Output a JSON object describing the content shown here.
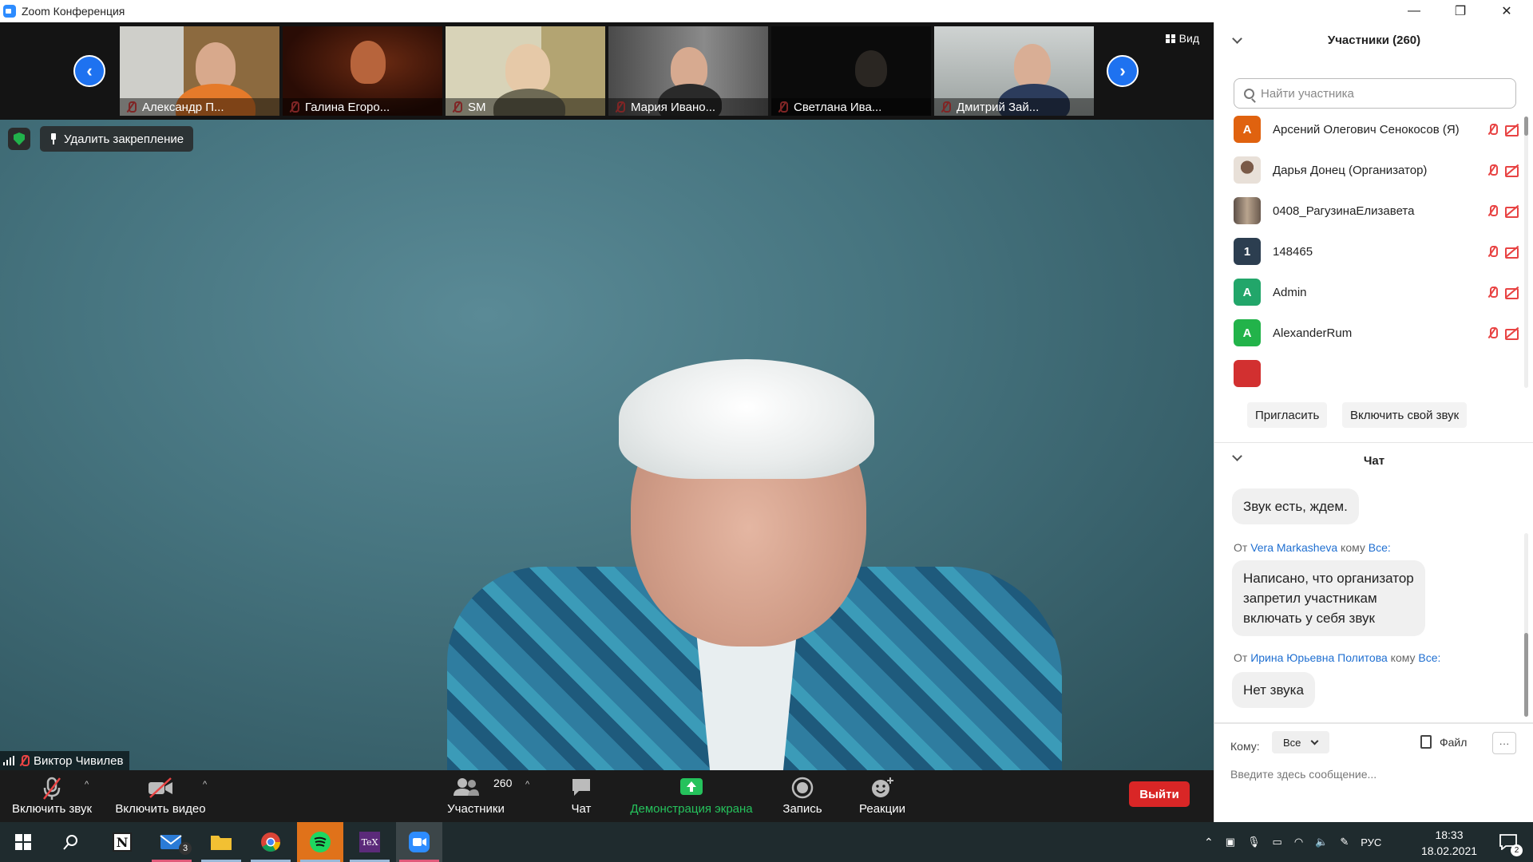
{
  "window": {
    "title": "Zoom Конференция",
    "controls": {
      "minimize": "—",
      "restore": "❐",
      "close": "✕"
    }
  },
  "thumbnails": {
    "view_label": "Вид",
    "items": [
      {
        "name": "Александр П...",
        "mic_muted": true
      },
      {
        "name": "Галина Егоро...",
        "mic_muted": true
      },
      {
        "name": "SM",
        "mic_muted": true
      },
      {
        "name": "Мария Ивано...",
        "mic_muted": true
      },
      {
        "name": "Светлана Ива...",
        "mic_muted": true
      },
      {
        "name": "Дмитрий Зай...",
        "mic_muted": true
      }
    ]
  },
  "main_video": {
    "unpin_label": "Удалить закрепление",
    "speaker_name": "Виктор Чивилев"
  },
  "toolbar": {
    "unmute_label": "Включить звук",
    "video_label": "Включить видео",
    "participants_label": "Участники",
    "participants_count": "260",
    "chat_label": "Чат",
    "share_label": "Демонстрация экрана",
    "record_label": "Запись",
    "reactions_label": "Реакции",
    "leave_label": "Выйти"
  },
  "participants_panel": {
    "title": "Участники (260)",
    "search_placeholder": "Найти участника",
    "participants": [
      {
        "name": "Арсений Олегович Сенокосов (Я)",
        "initial": "А",
        "color": "#e0620f"
      },
      {
        "name": "Дарья Донец (Организатор)",
        "initial": "",
        "color": "#c9b9ae"
      },
      {
        "name": "0408_РагузинаЕлизавета",
        "initial": "",
        "color": "#8a7c70"
      },
      {
        "name": "148465",
        "initial": "1",
        "color": "#2c3e50"
      },
      {
        "name": "Admin",
        "initial": "A",
        "color": "#22a66a"
      },
      {
        "name": "AlexanderRum",
        "initial": "A",
        "color": "#22b34a"
      }
    ],
    "invite_label": "Пригласить",
    "unmute_self_label": "Включить свой звук"
  },
  "chat": {
    "title": "Чат",
    "messages": [
      {
        "text": "Звук есть, ждем."
      },
      {
        "from_prefix": "От",
        "sender": "Vera Markasheva",
        "to_word": "кому",
        "recipient": "Все:",
        "text_lines": [
          "Написано, что организатор",
          "запретил участникам",
          "включать у себя звук"
        ]
      },
      {
        "from_prefix": "От",
        "sender": "Ирина Юрьевна Политова",
        "to_word": "кому",
        "recipient": "Все:",
        "text": "Нет звука"
      }
    ],
    "to_label": "Кому:",
    "to_value": "Все",
    "file_label": "Файл",
    "more_label": "···",
    "input_placeholder": "Введите здесь сообщение..."
  },
  "taskbar": {
    "mail_badge": "3",
    "notification_badge": "2",
    "language": "РУС",
    "time": "18:33",
    "date": "18.02.2021"
  },
  "colors": {
    "accent_blue": "#2d8cff",
    "leave_red": "#d92626",
    "share_green": "#25c25c",
    "muted_red": "#e84444"
  }
}
